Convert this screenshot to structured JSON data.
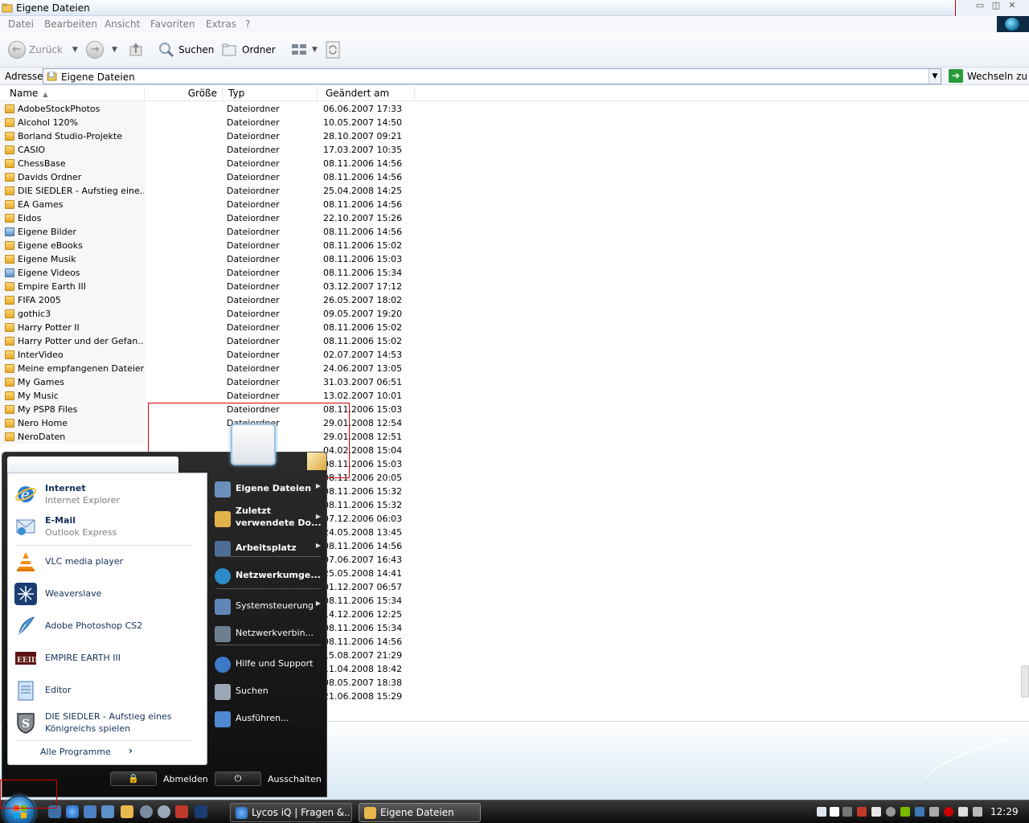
{
  "window": {
    "title": "Eigene Dateien",
    "controls": [
      "minimize",
      "maximize",
      "close"
    ]
  },
  "menubar": {
    "items": [
      "Datei",
      "Bearbeiten",
      "Ansicht",
      "Favoriten",
      "Extras",
      "?"
    ]
  },
  "toolbar": {
    "back_label": "Zurück",
    "search_label": "Suchen",
    "folders_label": "Ordner"
  },
  "address": {
    "label": "Adresse",
    "value": "Eigene Dateien",
    "go_label": "Wechseln zu"
  },
  "columns": {
    "name": "Name",
    "size": "Größe",
    "type": "Typ",
    "modified": "Geändert am"
  },
  "files": [
    {
      "name": "AdobeStockPhotos",
      "type": "Dateiordner",
      "date": "06.06.2007 17:33"
    },
    {
      "name": "Alcohol 120%",
      "type": "Dateiordner",
      "date": "10.05.2007 14:50"
    },
    {
      "name": "Borland Studio-Projekte",
      "type": "Dateiordner",
      "date": "28.10.2007 09:21"
    },
    {
      "name": "CASIO",
      "type": "Dateiordner",
      "date": "17.03.2007 10:35"
    },
    {
      "name": "ChessBase",
      "type": "Dateiordner",
      "date": "08.11.2006 14:56"
    },
    {
      "name": "Davids Ordner",
      "type": "Dateiordner",
      "date": "08.11.2006 14:56"
    },
    {
      "name": "DIE SIEDLER - Aufstieg eine...",
      "type": "Dateiordner",
      "date": "25.04.2008 14:25"
    },
    {
      "name": "EA Games",
      "type": "Dateiordner",
      "date": "08.11.2006 14:56"
    },
    {
      "name": "Eidos",
      "type": "Dateiordner",
      "date": "22.10.2007 15:26"
    },
    {
      "name": "Eigene Bilder",
      "type": "Dateiordner",
      "date": "08.11.2006 14:56",
      "special": true
    },
    {
      "name": "Eigene eBooks",
      "type": "Dateiordner",
      "date": "08.11.2006 15:02"
    },
    {
      "name": "Eigene Musik",
      "type": "Dateiordner",
      "date": "08.11.2006 15:03"
    },
    {
      "name": "Eigene Videos",
      "type": "Dateiordner",
      "date": "08.11.2006 15:34",
      "special": true
    },
    {
      "name": "Empire Earth III",
      "type": "Dateiordner",
      "date": "03.12.2007 17:12"
    },
    {
      "name": "FIFA 2005",
      "type": "Dateiordner",
      "date": "26.05.2007 18:02"
    },
    {
      "name": "gothic3",
      "type": "Dateiordner",
      "date": "09.05.2007 19:20"
    },
    {
      "name": "Harry Potter II",
      "type": "Dateiordner",
      "date": "08.11.2006 15:02"
    },
    {
      "name": "Harry Potter und der Gefan...",
      "type": "Dateiordner",
      "date": "08.11.2006 15:02"
    },
    {
      "name": "InterVideo",
      "type": "Dateiordner",
      "date": "02.07.2007 14:53"
    },
    {
      "name": "Meine empfangenen Dateien",
      "type": "Dateiordner",
      "date": "24.06.2007 13:05"
    },
    {
      "name": "My Games",
      "type": "Dateiordner",
      "date": "31.03.2007 06:51"
    },
    {
      "name": "My Music",
      "type": "Dateiordner",
      "date": "13.02.2007 10:01"
    },
    {
      "name": "My PSP8 Files",
      "type": "Dateiordner",
      "date": "08.11.2006 15:03"
    },
    {
      "name": "Nero Home",
      "type": "Dateiordner",
      "date": "29.01.2008 12:54"
    },
    {
      "name": "NeroDaten",
      "type": "",
      "date": "29.01.2008 12:51"
    },
    {
      "name": "",
      "type": "",
      "date": "04.02.2008 15:04"
    },
    {
      "name": "",
      "type": "",
      "date": "08.11.2006 15:03"
    },
    {
      "name": "",
      "type": "",
      "date": "08.11.2006 20:05"
    },
    {
      "name": "",
      "type": "",
      "date": "08.11.2006 15:32"
    },
    {
      "name": "",
      "type": "",
      "date": "08.11.2006 15:32"
    },
    {
      "name": "",
      "type": "",
      "date": "07.12.2006 06:03"
    },
    {
      "name": "",
      "type": "",
      "date": "24.05.2008 13:45"
    },
    {
      "name": "",
      "type": "",
      "date": "08.11.2006 14:56"
    },
    {
      "name": "",
      "type": "",
      "date": "07.06.2007 16:43"
    },
    {
      "name": "",
      "type": "",
      "date": "25.05.2008 14:41"
    },
    {
      "name": "",
      "type": "",
      "date": "01.12.2007 06:57"
    },
    {
      "name": "",
      "type": "",
      "date": "08.11.2006 15:34"
    },
    {
      "name": "",
      "type": "",
      "date": "14.12.2006 12:25"
    },
    {
      "name": "",
      "type": "",
      "date": "08.11.2006 15:34"
    },
    {
      "name": "",
      "type": "",
      "date": "08.11.2006 14:56"
    },
    {
      "name": "",
      "type": "",
      "date": "15.08.2007 21:29"
    },
    {
      "name": "",
      "type": "",
      "date": "11.04.2008 18:42"
    },
    {
      "name": "",
      "type": "",
      "date": "08.05.2007 18:38"
    },
    {
      "name": "",
      "type": "",
      "date": "21.06.2008 15:29"
    }
  ],
  "startmenu": {
    "pinned": [
      {
        "title": "Internet",
        "subtitle": "Internet Explorer",
        "icon": "internet-explorer-icon"
      },
      {
        "title": "E-Mail",
        "subtitle": "Outlook Express",
        "icon": "outlook-express-icon"
      }
    ],
    "recent": [
      {
        "title": "VLC media player",
        "icon": "vlc-icon"
      },
      {
        "title": "Weaverslave",
        "icon": "weaverslave-icon"
      },
      {
        "title": "Adobe Photoshop   CS2",
        "icon": "photoshop-icon"
      },
      {
        "title": "EMPIRE EARTH III",
        "icon": "empire-earth-icon"
      },
      {
        "title": "Editor",
        "icon": "notepad-icon"
      },
      {
        "title": "DIE SIEDLER - Aufstieg eines",
        "title2": "Königreichs spielen",
        "icon": "siedler-icon"
      }
    ],
    "all_programs": "Alle Programme",
    "places": [
      {
        "label": "Eigene Dateien",
        "bold": true,
        "arrow": true
      },
      {
        "label": "Zuletzt",
        "label2": "verwendete Do...",
        "bold": true,
        "arrow": true
      },
      {
        "label": "Arbeitsplatz",
        "bold": true,
        "arrow": true
      },
      {
        "label": "Netzwerkumge...",
        "bold": true,
        "arrow": false
      },
      {
        "label": "Systemsteuerung",
        "bold": false,
        "arrow": true
      },
      {
        "label": "Netzwerkverbin...",
        "bold": false,
        "arrow": false
      },
      {
        "label": "Hilfe und Support",
        "bold": false,
        "arrow": false
      },
      {
        "label": "Suchen",
        "bold": false,
        "arrow": false
      },
      {
        "label": "Ausführen...",
        "bold": false,
        "arrow": false
      }
    ],
    "logoff_label": "Abmelden",
    "shutdown_label": "Ausschalten"
  },
  "taskbar": {
    "tasks": [
      {
        "label": "Lycos iQ | Fragen &...",
        "active": false
      },
      {
        "label": "Eigene Dateien",
        "active": true
      }
    ],
    "clock": "12:29"
  },
  "colors": {
    "accent": "#1d6fb0",
    "taskbar": "#1a1a1a",
    "selection_border": "#dd0000"
  }
}
